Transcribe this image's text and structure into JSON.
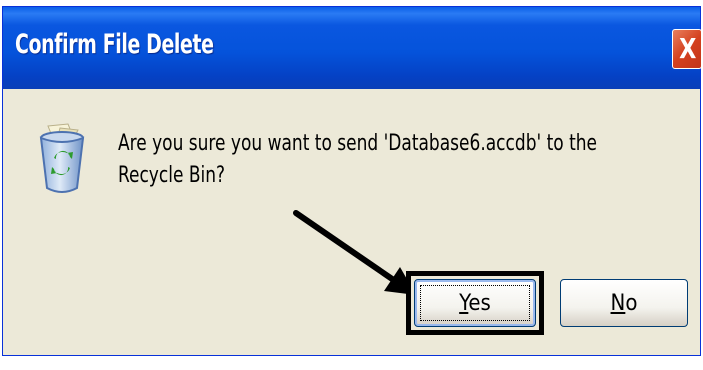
{
  "window": {
    "title": "Confirm File Delete",
    "close_icon": "close-icon",
    "close_glyph": "X"
  },
  "dialog": {
    "icon": "recycle-bin-icon",
    "message": "Are you sure you want to send 'Database6.accdb' to the Recycle Bin?"
  },
  "buttons": {
    "yes_mnemonic": "Y",
    "yes_rest": "es",
    "no_mnemonic": "N",
    "no_rest": "o"
  },
  "annotation": {
    "arrow_icon": "arrow-icon",
    "highlight": "yes-button-highlight"
  },
  "colors": {
    "titlebar": "#0553db",
    "dialog_bg": "#ece9d8",
    "close_button": "#d4411f",
    "annotation": "#000000"
  }
}
